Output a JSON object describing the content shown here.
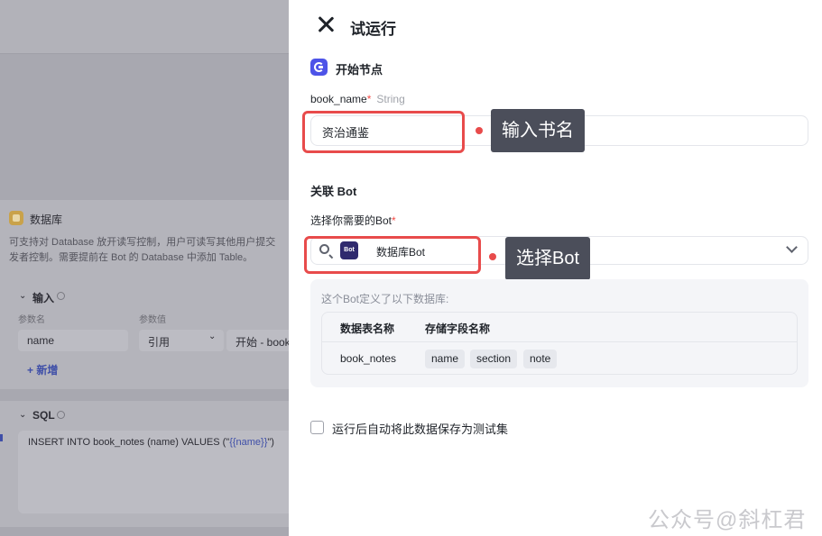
{
  "background": {
    "node_title": "数据库",
    "description_line1": "可支持对 Database 放开读写控制，用户可读写其他用户提交",
    "description_line2": "发者控制。需要提前在 Bot 的 Database 中添加 Table。",
    "input_section": {
      "heading": "输入",
      "param_name_header": "参数名",
      "param_value_header": "参数值",
      "param_name": "name",
      "param_type": "引用",
      "param_ref": "开始 - book",
      "add_label": "+ 新增"
    },
    "sql_section": {
      "heading": "SQL",
      "sql_prefix": "INSERT INTO book_notes (name) VALUES (\"",
      "sql_var": "{{name}}",
      "sql_suffix": "\")"
    }
  },
  "drawer": {
    "title": "试运行",
    "start_node": {
      "heading": "开始节点",
      "field_label": "book_name",
      "required_mark": "*",
      "field_type": "String",
      "field_value": "资治通鉴"
    },
    "callout_input": "输入书名",
    "bot_section": {
      "heading": "关联 Bot",
      "select_label": "选择你需要的Bot",
      "required_mark": "*",
      "avatar_text": "Bot",
      "bot_name": "数据库Bot"
    },
    "callout_bot": "选择Bot",
    "db_info": {
      "title": "这个Bot定义了以下数据库:",
      "col_table": "数据表名称",
      "col_fields": "存储字段名称",
      "table_name": "book_notes",
      "fields": [
        "name",
        "section",
        "note"
      ]
    },
    "save_checkbox_label": "运行后自动将此数据保存为测试集"
  },
  "watermark": "公众号@斜杠君",
  "colors": {
    "accent": "#4d53e8",
    "highlight_red": "#e84b4b",
    "callout_bg": "#4b4e5a"
  }
}
